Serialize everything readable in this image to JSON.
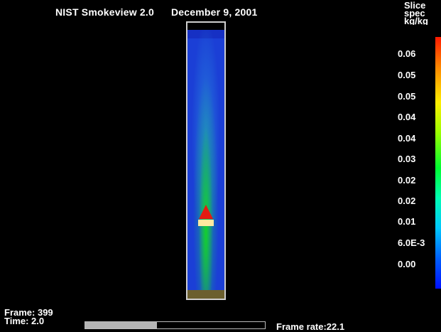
{
  "header": {
    "app_title": "NIST Smokeview 2.0",
    "date": "December 9, 2001"
  },
  "legend": {
    "heading": [
      "Slice",
      "spec",
      "kg/kg"
    ],
    "ticks": [
      "0.06",
      "0.05",
      "0.05",
      "0.04",
      "0.04",
      "0.03",
      "0.02",
      "0.02",
      "0.01",
      "6.0E-3",
      "0.00"
    ]
  },
  "status": {
    "frame_label": "Frame: 399",
    "time_label": "Time:  2.0",
    "frame_rate_label": "Frame rate:22.1",
    "progress_fraction": 0.4
  },
  "colors": {
    "background": "#000000",
    "slice_blue": "#1b3fd6",
    "fire_red": "#e41b12",
    "burner_yellow": "#ffe9a0",
    "floor": "#6b5f2e"
  }
}
